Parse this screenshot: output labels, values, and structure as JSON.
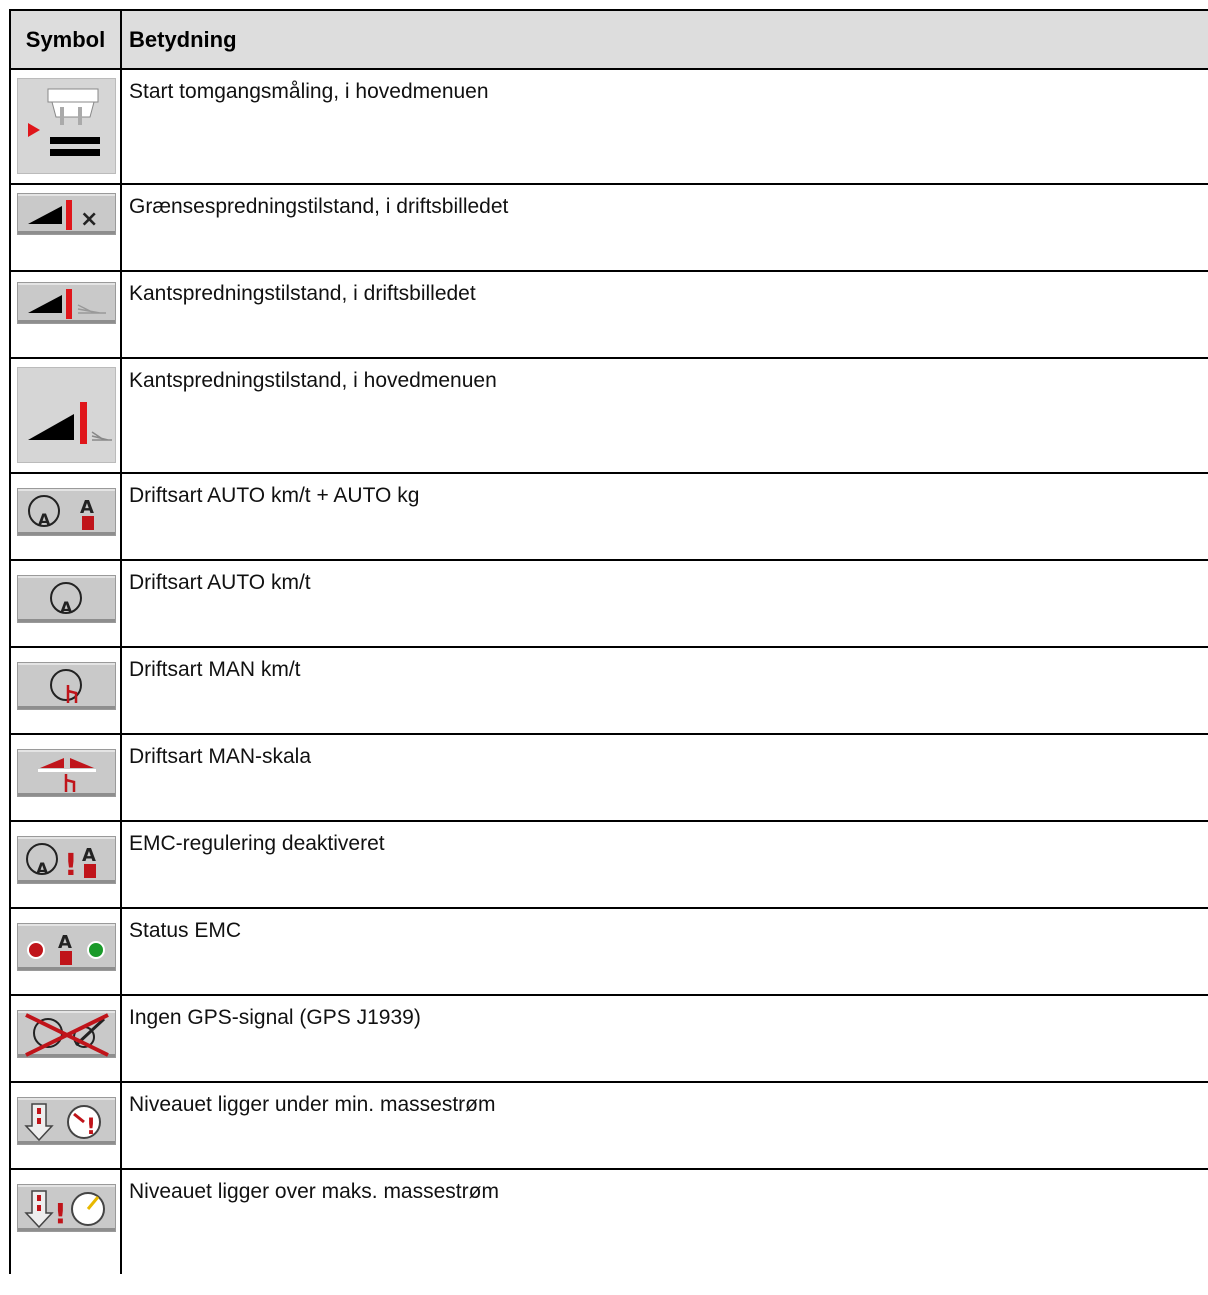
{
  "table": {
    "header": {
      "symbol": "Symbol",
      "meaning": "Betydning"
    },
    "rows": [
      {
        "icon": "start-idle-measurement-icon",
        "text": "Start tomgangsmåling, i hovedmenuen"
      },
      {
        "icon": "limit-spreading-mode-icon",
        "text": "Grænsespredningstilstand, i driftsbilledet"
      },
      {
        "icon": "edge-spreading-mode-icon",
        "text": "Kantspredningstilstand, i driftsbilledet"
      },
      {
        "icon": "edge-spreading-mode-main-icon",
        "text": "Kantspredningstilstand, i hovedmenuen"
      },
      {
        "icon": "auto-kmh-auto-kg-icon",
        "text": "Driftsart AUTO km/t + AUTO kg"
      },
      {
        "icon": "auto-kmh-icon",
        "text": "Driftsart AUTO km/t"
      },
      {
        "icon": "man-kmh-icon",
        "text": "Driftsart MAN km/t"
      },
      {
        "icon": "man-scale-icon",
        "text": "Driftsart MAN-skala"
      },
      {
        "icon": "emc-deactivated-icon",
        "text": "EMC-regulering deaktiveret"
      },
      {
        "icon": "emc-status-icon",
        "text": "Status EMC"
      },
      {
        "icon": "no-gps-signal-icon",
        "text": "Ingen GPS-signal (GPS J1939)"
      },
      {
        "icon": "level-below-min-flow-icon",
        "text": "Niveauet ligger under min. massestrøm"
      },
      {
        "icon": "level-above-max-flow-icon",
        "text": "Niveauet ligger over maks. massestrøm"
      }
    ]
  }
}
